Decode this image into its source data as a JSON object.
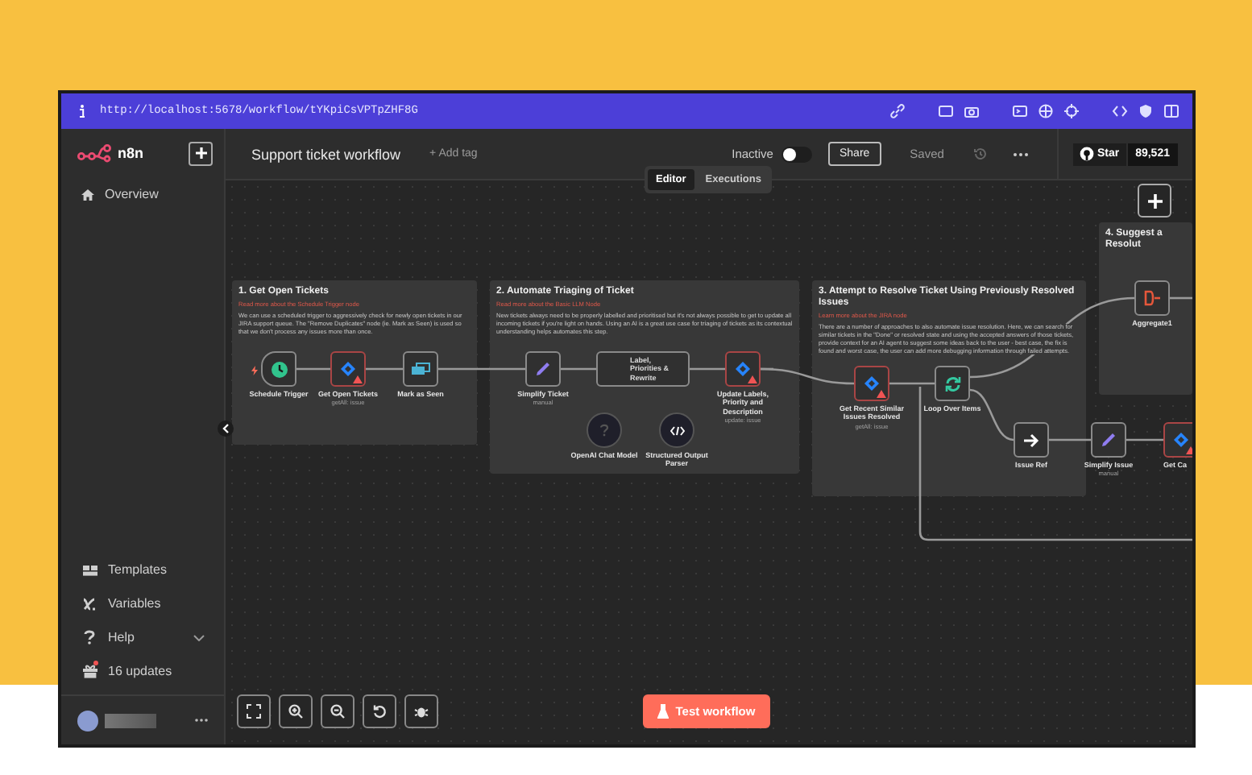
{
  "browser": {
    "url": "http://localhost:5678/workflow/tYKpiCsVPTpZHF8G"
  },
  "sidebar": {
    "brand": "n8n",
    "items": [
      {
        "label": "Overview"
      }
    ],
    "bottom_items": [
      {
        "label": "Templates",
        "expandable": false,
        "badge": false
      },
      {
        "label": "Variables",
        "expandable": false,
        "badge": false
      },
      {
        "label": "Help",
        "expandable": true,
        "badge": false
      },
      {
        "label": "16 updates",
        "expandable": false,
        "badge": true
      }
    ]
  },
  "header": {
    "title": "Support ticket workflow",
    "add_tag": "+ Add tag",
    "active_label": "Inactive",
    "active": false,
    "share": "Share",
    "save_status": "Saved",
    "github": {
      "label": "Star",
      "count": "89,521"
    }
  },
  "tabs": [
    {
      "label": "Editor",
      "selected": true
    },
    {
      "label": "Executions",
      "selected": false
    }
  ],
  "notes": [
    {
      "title": "1. Get Open Tickets",
      "link": "Read more about the Schedule Trigger node",
      "body": "We can use a scheduled trigger to aggressively check for newly open tickets in our JIRA support queue. The \"Remove Duplicates\" node (ie. Mark as Seen) is used so that we don't process any issues more than once."
    },
    {
      "title": "2. Automate Triaging of Ticket",
      "link": "Read more about the Basic LLM Node",
      "body": "New tickets always need to be properly labelled and prioritised but it's not always possible to get to update all incoming tickets if you're light on hands. Using an AI is a great use case for triaging of tickets as its contextual understanding helps automates this step."
    },
    {
      "title": "3. Attempt to Resolve Ticket Using Previously Resolved Issues",
      "link": "Learn more about the JIRA node",
      "body": "There are a number of approaches to also automate issue resolution. Here, we can search for similar tickets in the \"Done\" or resolved state and using the accepted answers of those tickets, provide context for an AI agent to suggest some ideas back to the user - best case, the fix is found and worst case, the user can add more debugging information through failed attempts."
    },
    {
      "title": "4. Suggest a Resolut"
    }
  ],
  "nodes": [
    {
      "label": "Schedule Trigger",
      "kind": "trigger",
      "warning": false
    },
    {
      "label": "Get Open Tickets",
      "subtitle": "getAll: issue",
      "kind": "action",
      "warning": true
    },
    {
      "label": "Mark as Seen",
      "kind": "action",
      "warning": false
    },
    {
      "label": "Simplify Ticket",
      "subtitle": "manual",
      "kind": "action",
      "warning": false
    },
    {
      "label": "Label, Priorities & Rewrite",
      "kind": "agent",
      "warning": false
    },
    {
      "label": "Update Labels, Priority and Description",
      "subtitle": "update: issue",
      "kind": "action",
      "warning": true
    },
    {
      "label": "OpenAI Chat Model",
      "kind": "sub",
      "warning": false
    },
    {
      "label": "Structured Output Parser",
      "kind": "sub",
      "warning": false
    },
    {
      "label": "Get Recent Similar Issues Resolved",
      "subtitle": "getAll: issue",
      "kind": "action",
      "warning": true
    },
    {
      "label": "Loop Over Items",
      "kind": "action",
      "warning": false
    },
    {
      "label": "Aggregate1",
      "kind": "action",
      "warning": false
    },
    {
      "label": "Issue Ref",
      "kind": "action",
      "warning": false
    },
    {
      "label": "Simplify Issue",
      "subtitle": "manual",
      "kind": "action",
      "warning": false
    },
    {
      "label": "Get Ca",
      "kind": "action",
      "warning": true
    }
  ],
  "test_button": "Test workflow"
}
